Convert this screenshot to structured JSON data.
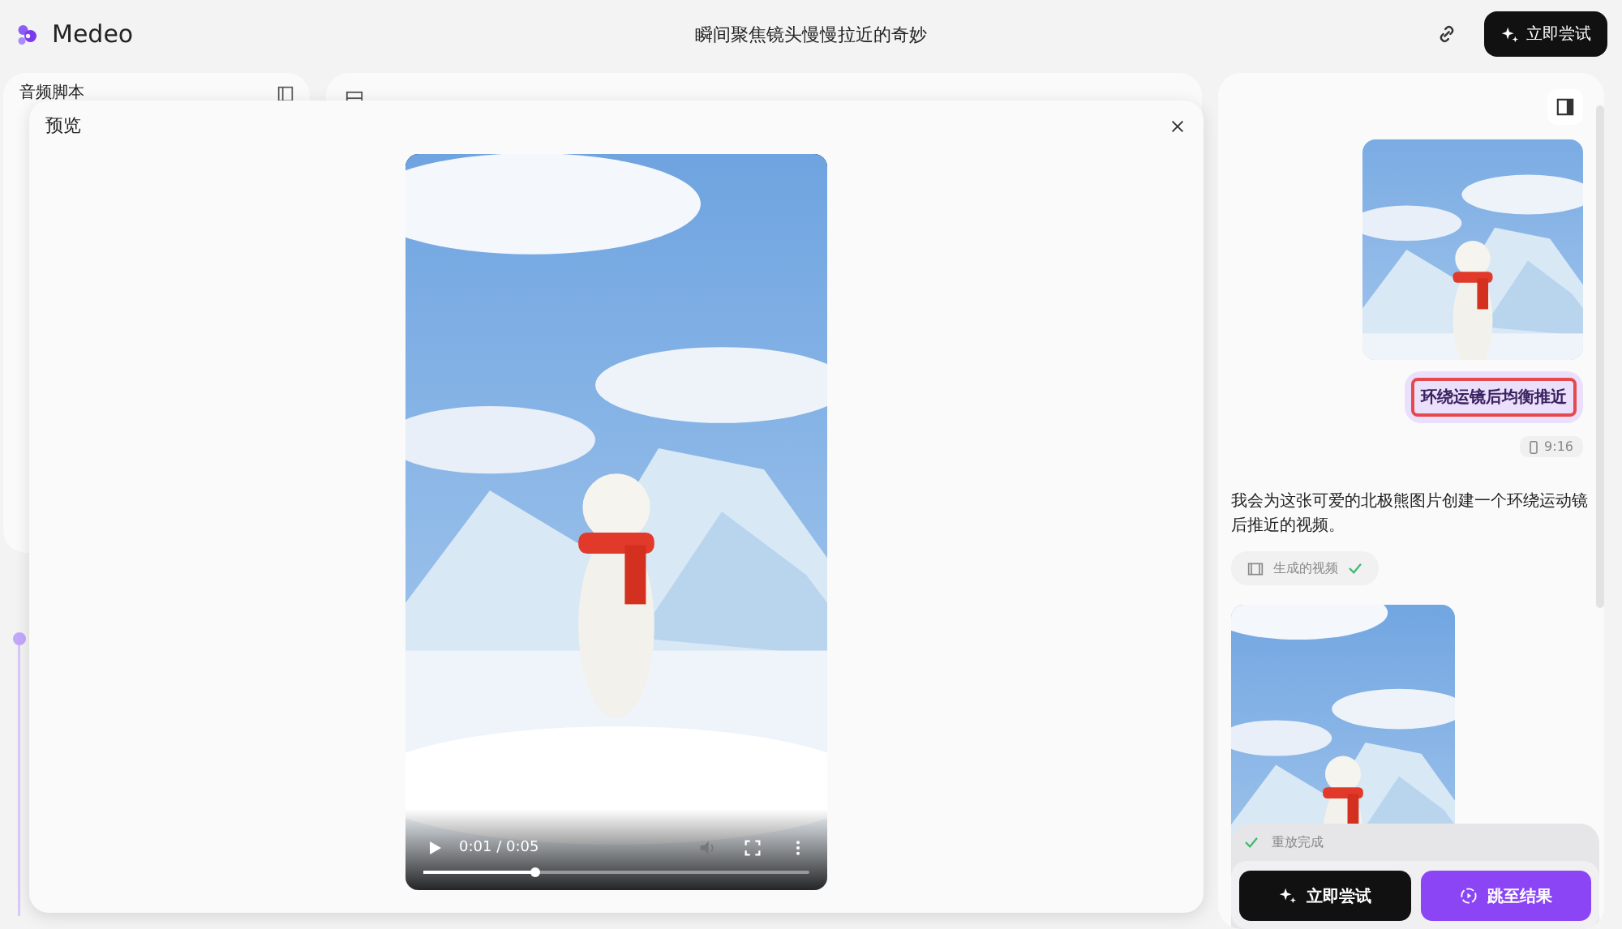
{
  "app": {
    "name": "Medeo"
  },
  "header": {
    "title": "瞬间聚焦镜头慢慢拉近的奇妙",
    "try_button": "立即尝试"
  },
  "left_panel": {
    "title": "音频脚本"
  },
  "preview": {
    "title": "预览",
    "video": {
      "kind": "picture",
      "time": "0:01 / 0:05",
      "level": 0.29
    }
  },
  "chat": [
    {
      "kind": "user",
      "text": "环绕运镜后均衡推近",
      "aspect": "9:16"
    },
    {
      "kind": "assistant",
      "text": "我会为这张可爱的北极熊图片创建一个环绕运动镜后推近的视频。",
      "chip": {
        "label": "生成的视频",
        "done": true
      }
    }
  ],
  "status": {
    "text": "重放完成",
    "done": true
  },
  "actions": [
    {
      "label": "立即尝试",
      "kind": "dark"
    },
    {
      "label": "跳至结果",
      "kind": "primary"
    }
  ]
}
